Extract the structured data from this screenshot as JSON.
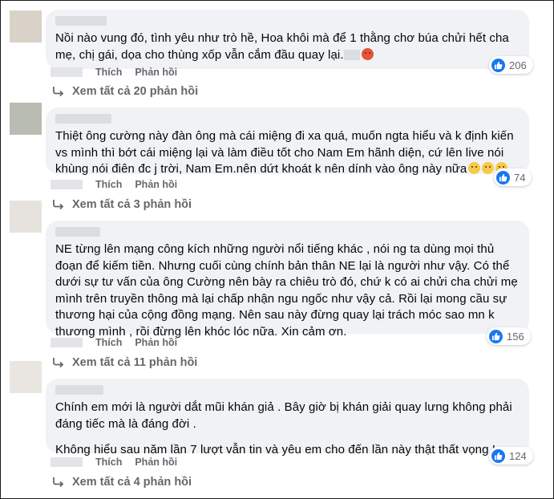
{
  "colors": {
    "bubble": "#f0f2f5",
    "like_blue": "#1877f2",
    "meta_gray": "#65676b",
    "text": "#050505"
  },
  "comments": [
    {
      "paragraphs": [
        "Nồi nào vung đó, tình yêu như trò hề, Hoa khôi mà để 1 thằng chơ búa chửi hết cha mẹ, chị gái, dọa cho thùng xốp vẫn cắm đầu quay lại."
      ],
      "emoji": [
        "angry-face-icon"
      ],
      "likes": "206",
      "actions": [
        "Thích",
        "Phản hồi"
      ],
      "view_replies": "Xem tất cả 20 phản hồi"
    },
    {
      "paragraphs": [
        "Thiệt ông cường này đàn ông mà cái miệng đi xa quá, muốn ngta hiểu và k định kiến vs mình thì bớt cái miệng lại và làm điều tốt cho Nam Em hãnh diện, cứ lên live nói khùng nói điên đc j trời, Nam Em.nên dứt khoát k nên dính vào ông này nữa"
      ],
      "emoji": [
        "sad-face-icon",
        "sad-face-icon",
        "sad-face-icon"
      ],
      "likes": "74",
      "actions": [
        "Thích",
        "Phản hồi"
      ],
      "view_replies": "Xem tất cả 3 phản hồi"
    },
    {
      "paragraphs": [
        "NE từng lên mạng công kích những người nổi tiếng khác , nói ng ta dùng mọi thủ đoạn để kiếm tiền. Nhưng cuối cùng chính bản thân NE lại là người như vậy. Có thể dưới sự tư vấn của ông Cường nên bày ra chiêu trò đó, chứ k có ai chửi cha chửi mẹ mình trên truyền thông mà lại chấp nhận ngu ngốc như vậy cả. Rồi lại mong cầu sự thương hại của cộng đồng mạng. Nên sau này đừng quay lại trách móc sao mn k thương mình , rồi đừng lên khóc lóc nữa. Xin cảm ơn."
      ],
      "emoji": [],
      "likes": "156",
      "actions": [
        "Thích",
        "Phản hồi"
      ],
      "view_replies": "Xem tất cả 11 phản hồi"
    },
    {
      "paragraphs": [
        "Chính em mới là người dắt mũi khán giả . Bây giờ bị khán giải quay lưng không phải đáng tiếc mà là đáng đời .",
        "Không hiểu sau năm lần 7 lượt vẫn tin và yêu em cho đến lần này thật thất vọng !"
      ],
      "emoji": [],
      "likes": "124",
      "actions": [
        "Thích",
        "Phản hồi"
      ],
      "view_replies": "Xem tất cả 4 phản hồi"
    }
  ]
}
